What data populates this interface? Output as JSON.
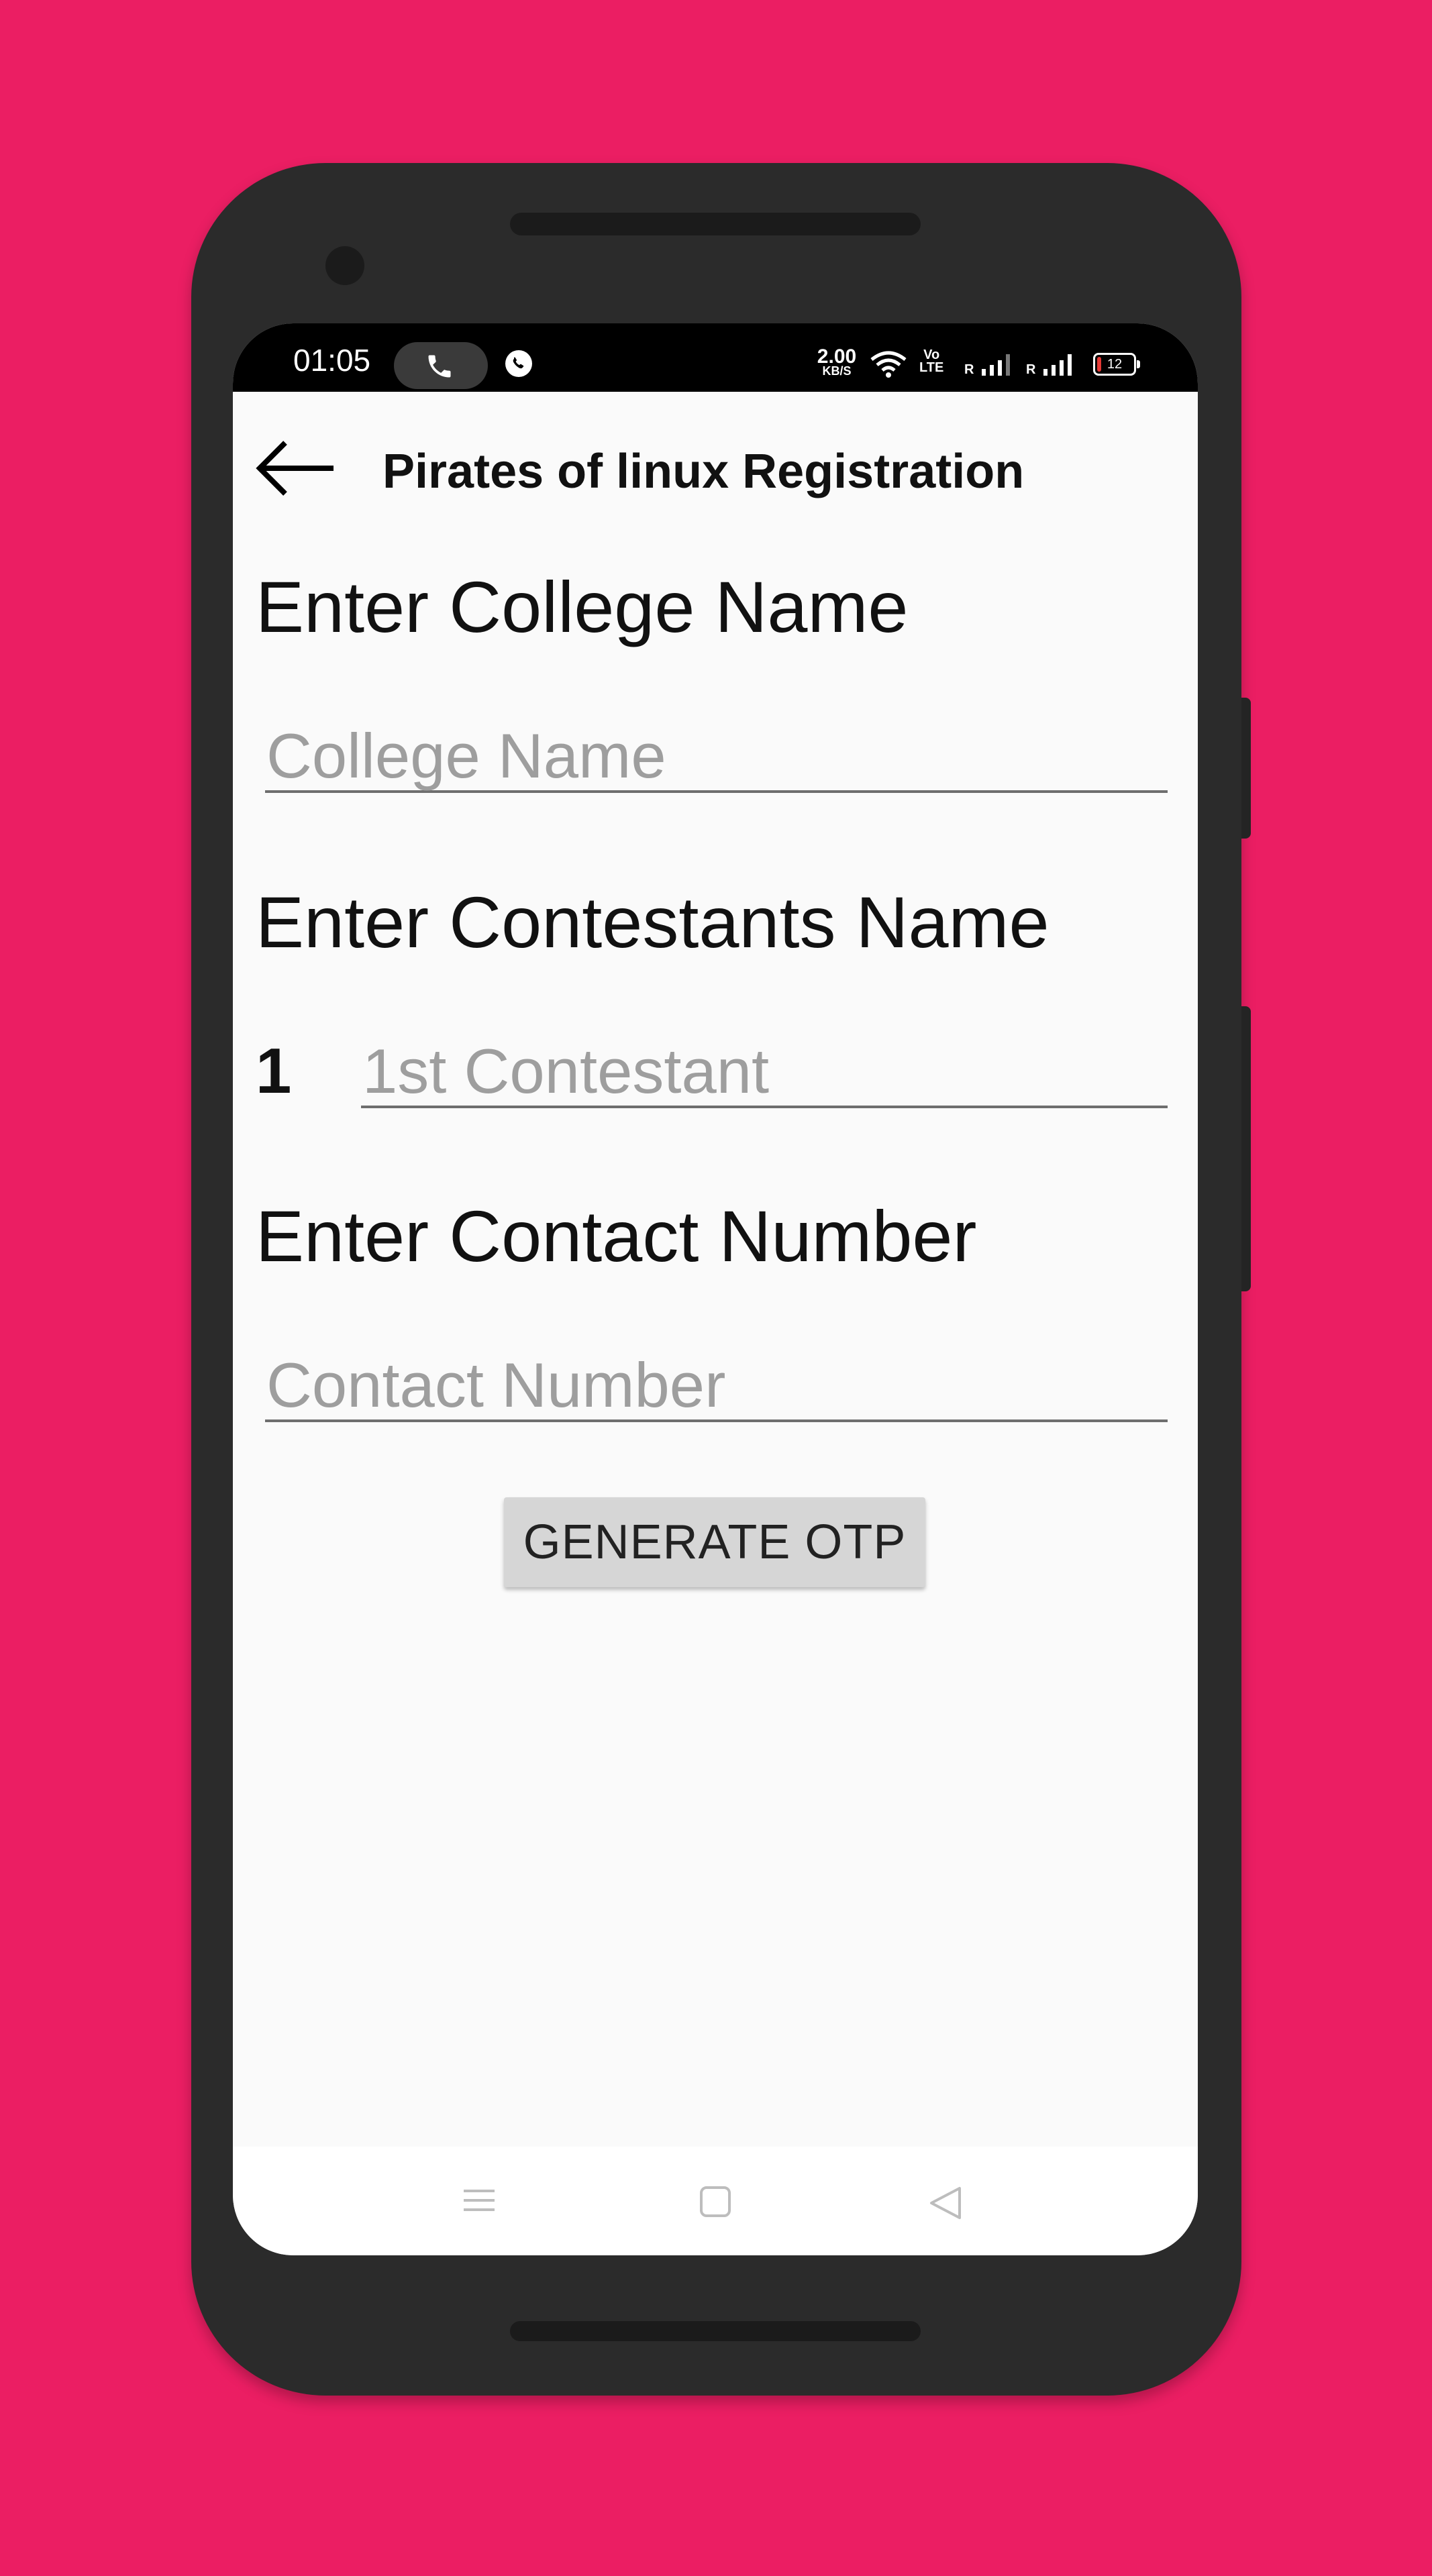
{
  "status_bar": {
    "time": "01:05",
    "speed_value": "2.00",
    "speed_unit": "KB/S",
    "volte_line1": "Vo",
    "volte_line2": "LTE",
    "signal1_label": "R",
    "signal2_label": "R",
    "battery_level": "12"
  },
  "app_bar": {
    "title": "Pirates of linux Registration"
  },
  "form": {
    "college_heading": "Enter College Name",
    "college_placeholder": "College Name",
    "contestants_heading": "Enter Contestants Name",
    "contestant_index": "1",
    "contestant_placeholder": "1st Contestant",
    "contact_heading": "Enter Contact Number",
    "contact_placeholder": "Contact Number",
    "otp_button_label": "GENERATE OTP"
  },
  "colors": {
    "background": "#EB1E63",
    "device": "#2B2B2B",
    "screen": "#FAFAFA",
    "button": "#D6D6D6"
  },
  "icons": {
    "back": "arrow-left-icon",
    "call": "phone-icon",
    "whatsapp": "whatsapp-icon",
    "wifi": "wifi-icon",
    "nav_menu": "menu-icon",
    "nav_home": "home-square-icon",
    "nav_back": "back-triangle-icon"
  }
}
